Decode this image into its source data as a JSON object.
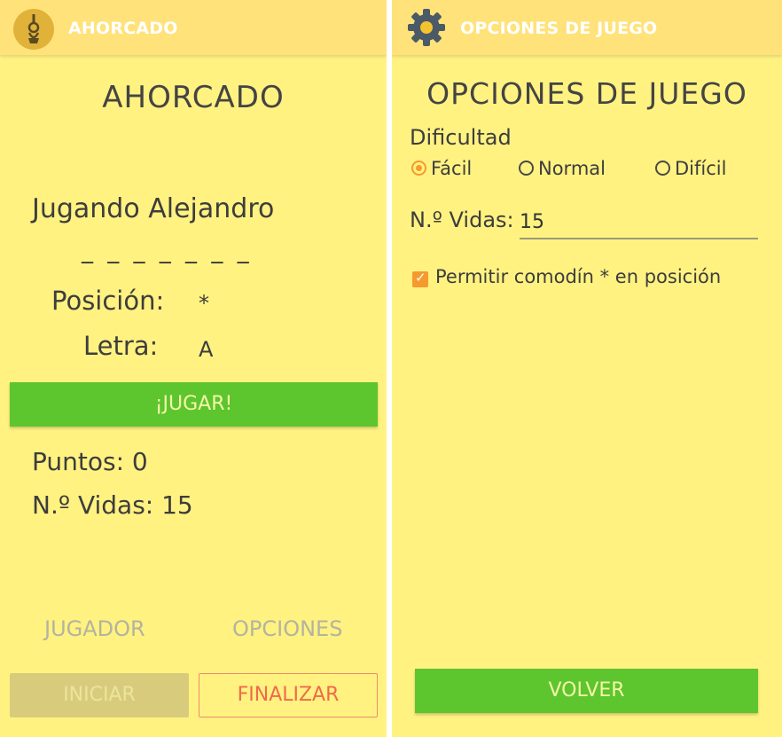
{
  "left": {
    "appbar_title": "AHORCADO",
    "title": "AHORCADO",
    "playing_text": "Jugando Alejandro",
    "word_mask": "_ _ _ _ _ _ _",
    "position_label": "Posición:",
    "position_value": "*",
    "letter_label": "Letra:",
    "letter_value": "A",
    "play_button": "¡JUGAR!",
    "points_text": "Puntos: 0",
    "lives_text": "N.º Vidas: 15",
    "player_button": "JUGADOR",
    "options_button": "OPCIONES",
    "start_button": "INICIAR",
    "finish_button": "FINALIZAR"
  },
  "right": {
    "appbar_title": "OPCIONES DE JUEGO",
    "title": "OPCIONES DE JUEGO",
    "difficulty_label": "Dificultad",
    "difficulty_options": [
      "Fácil",
      "Normal",
      "Difícil"
    ],
    "difficulty_selected": "Fácil",
    "lives_label": "N.º Vidas:",
    "lives_value": "15",
    "wildcard_label": "Permitir comodín * en posición",
    "wildcard_checked": true,
    "back_button": "VOLVER"
  },
  "colors": {
    "background": "#fff281",
    "appbar": "#ffe27a",
    "primary_button": "#5dc52e",
    "accent": "#f59a2f",
    "danger": "#f06a4a"
  },
  "icons": {
    "left_appbar": "hangman-noose-icon",
    "right_appbar": "gear-icon"
  }
}
